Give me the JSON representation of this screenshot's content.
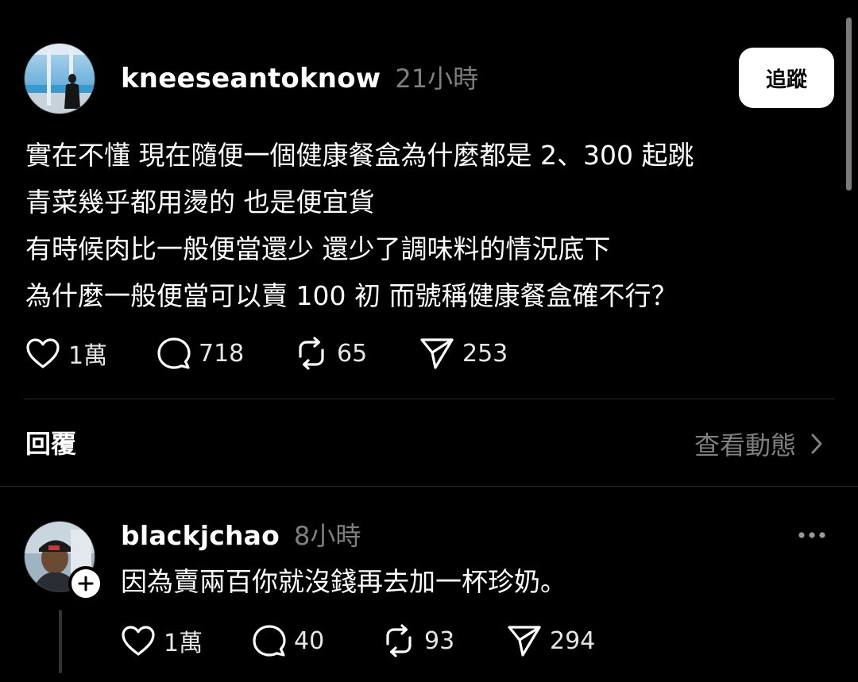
{
  "post": {
    "username": "kneeseantoknow",
    "timestamp": "21小時",
    "follow_label": "追蹤",
    "avatar_icon": "avatar-window-silhouette",
    "lines": [
      "實在不懂 現在隨便一個健康餐盒為什麼都是 2、300 起跳",
      "青菜幾乎都用燙的 也是便宜貨",
      "有時候肉比一般便當還少 還少了調味料的情況底下",
      "為什麼一般便當可以賣 100 初 而號稱健康餐盒確不行？"
    ],
    "actions": {
      "likes": "1萬",
      "comments": "718",
      "reposts": "65",
      "shares": "253"
    }
  },
  "replies_section": {
    "heading": "回覆",
    "view_activity_label": "查看動態"
  },
  "reply": {
    "username": "blackjchao",
    "timestamp": "8小時",
    "text": "因為賣兩百你就沒錢再去加一杯珍奶。",
    "avatar_icon": "avatar-person-cap",
    "actions": {
      "likes": "1萬",
      "comments": "40",
      "reposts": "93",
      "shares": "294"
    }
  },
  "icons": {
    "like": "heart-icon",
    "comment": "comment-bubble-icon",
    "repost": "repost-icon",
    "share": "send-icon",
    "more": "more-dots-icon",
    "add": "plus-icon",
    "chevron": "chevron-right-icon"
  },
  "colors": {
    "background": "#000000",
    "text": "#ffffff",
    "muted": "#7f7f7f",
    "divider": "#2a2a2a",
    "button_bg": "#ffffff"
  }
}
